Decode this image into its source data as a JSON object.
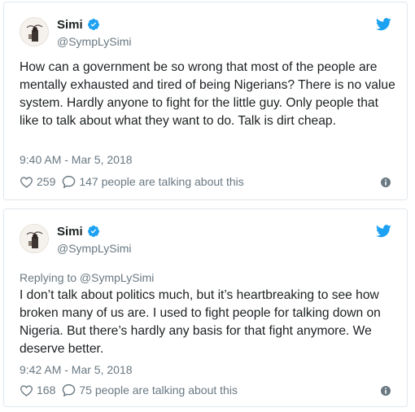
{
  "colors": {
    "twitter_blue": "#1da1f2",
    "text": "#1c2022",
    "secondary_text": "#697882",
    "border": "#e1e8ed"
  },
  "tweets": [
    {
      "author": {
        "name": "Simi",
        "handle": "@SympLySimi",
        "verified": true,
        "avatar_icon": "avatar-image"
      },
      "text": "How can a government be so wrong that most of the people are mentally exhausted and tired of being Nigerians? There is no value system. Hardly anyone to fight for the little guy. Only people that like to talk about what they want to do. Talk is dirt cheap.",
      "timestamp": "9:40 AM - Mar 5, 2018",
      "likes": "259",
      "talking": "147 people are talking about this"
    },
    {
      "author": {
        "name": "Simi",
        "handle": "@SympLySimi",
        "verified": true,
        "avatar_icon": "avatar-image"
      },
      "replying_to": "Replying to @SympLySimi",
      "text": "I don’t talk about politics much, but it’s heartbreaking to see how broken many of us are. I used to fight people for talking down on Nigeria. But there’s hardly any basis for that fight anymore. We deserve better.",
      "timestamp": "9:42 AM - Mar 5, 2018",
      "likes": "168",
      "talking": "75 people are talking about this"
    }
  ]
}
